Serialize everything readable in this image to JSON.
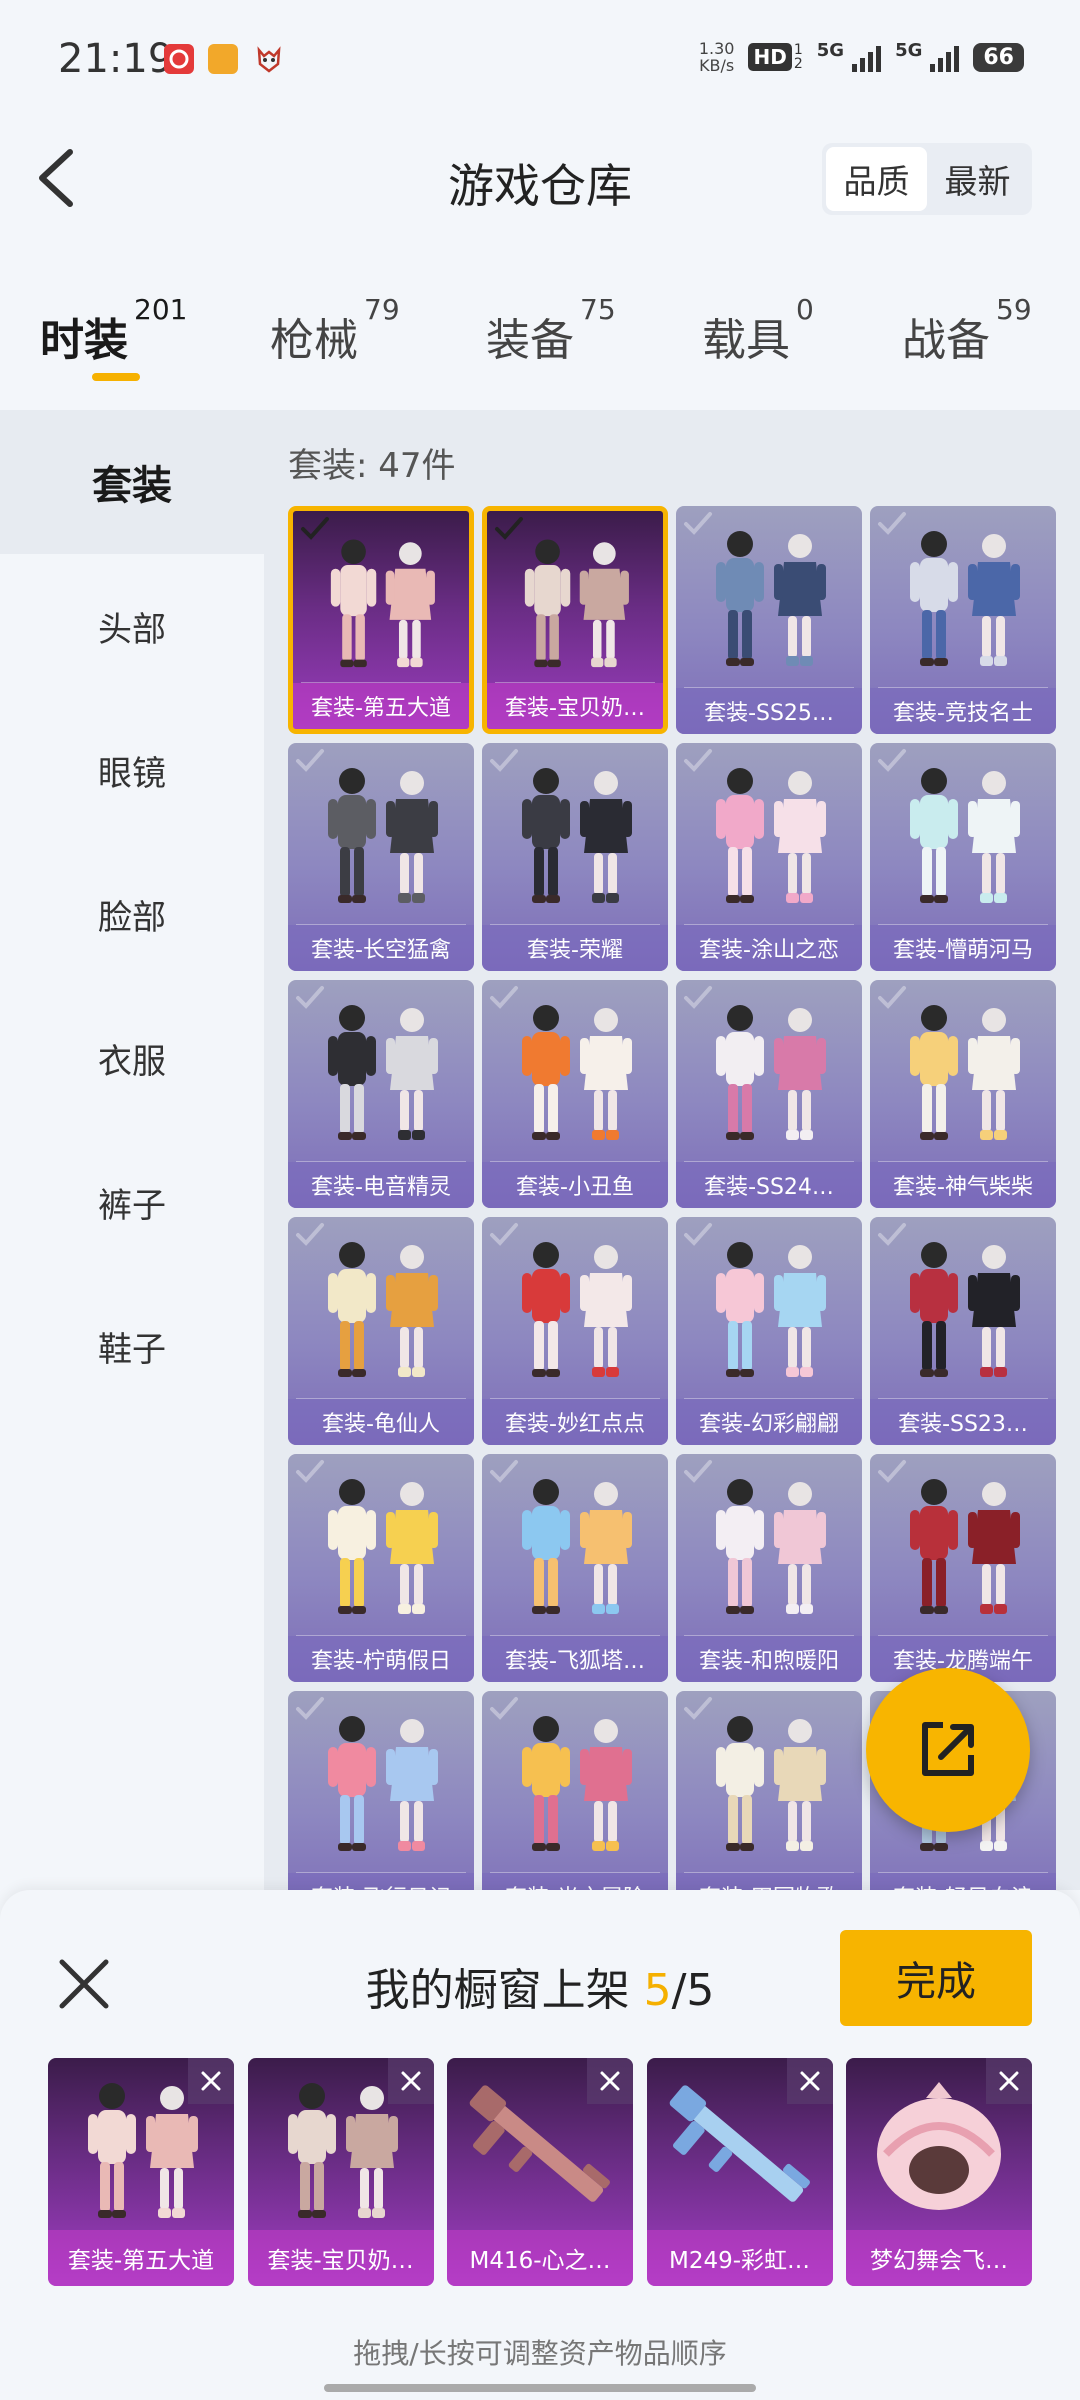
{
  "status_bar": {
    "time": "21:19",
    "net_speed_value": "1.30",
    "net_speed_unit": "KB/s",
    "hd_label": "HD",
    "sim1": "1",
    "sim2": "2",
    "sig1_label": "5G",
    "sig2_label": "5G",
    "battery": "66",
    "app_icons": [
      "netease-music-icon",
      "game-app-icon",
      "demon-mask-icon"
    ]
  },
  "header": {
    "title": "游戏仓库",
    "sort_options": [
      "品质",
      "最新"
    ],
    "sort_selected": "品质"
  },
  "tabs": [
    {
      "label": "时装",
      "count": "201",
      "active": true
    },
    {
      "label": "枪械",
      "count": "79",
      "active": false
    },
    {
      "label": "装备",
      "count": "75",
      "active": false
    },
    {
      "label": "载具",
      "count": "0",
      "active": false
    },
    {
      "label": "战备",
      "count": "59",
      "active": false
    }
  ],
  "sidebar": {
    "items": [
      {
        "label": "套装",
        "active": true
      },
      {
        "label": "头部",
        "active": false
      },
      {
        "label": "眼镜",
        "active": false
      },
      {
        "label": "脸部",
        "active": false
      },
      {
        "label": "衣服",
        "active": false
      },
      {
        "label": "裤子",
        "active": false
      },
      {
        "label": "鞋子",
        "active": false
      }
    ]
  },
  "main": {
    "count_text": "套装: 47件",
    "items": [
      {
        "label": "套装-第五大道",
        "selected": true,
        "colors": [
          "#f2d9d4",
          "#e9b9b5"
        ]
      },
      {
        "label": "套装-宝贝奶…",
        "selected": true,
        "colors": [
          "#e7d7cf",
          "#c9a8a0"
        ]
      },
      {
        "label": "套装-SS25…",
        "selected": false,
        "colors": [
          "#6f8bb5",
          "#3a4c74"
        ]
      },
      {
        "label": "套装-竞技名士",
        "selected": false,
        "colors": [
          "#d7dbe8",
          "#4b67a8"
        ]
      },
      {
        "label": "套装-长空猛禽",
        "selected": false,
        "colors": [
          "#5c5d63",
          "#3c3d44"
        ]
      },
      {
        "label": "套装-荣耀",
        "selected": false,
        "colors": [
          "#3a3b44",
          "#2a2b33"
        ]
      },
      {
        "label": "套装-涂山之恋",
        "selected": false,
        "colors": [
          "#f1a9c9",
          "#f6e0e8"
        ]
      },
      {
        "label": "套装-懵萌河马",
        "selected": false,
        "colors": [
          "#c9ecee",
          "#eef4f6"
        ]
      },
      {
        "label": "套装-电音精灵",
        "selected": false,
        "colors": [
          "#2e2e33",
          "#d9d9de"
        ]
      },
      {
        "label": "套装-小丑鱼",
        "selected": false,
        "colors": [
          "#f07a30",
          "#f6f0ea"
        ]
      },
      {
        "label": "套装-SS24…",
        "selected": false,
        "colors": [
          "#f2eef2",
          "#d87aa9"
        ]
      },
      {
        "label": "套装-神气柴柴",
        "selected": false,
        "colors": [
          "#f6d07a",
          "#f3f0ea"
        ]
      },
      {
        "label": "套装-龟仙人",
        "selected": false,
        "colors": [
          "#f2e8c8",
          "#e6a040"
        ]
      },
      {
        "label": "套装-妙红点点",
        "selected": false,
        "colors": [
          "#d83a3a",
          "#f3e8e8"
        ]
      },
      {
        "label": "套装-幻彩翩翩",
        "selected": false,
        "colors": [
          "#f6c7d6",
          "#a6d6f2"
        ]
      },
      {
        "label": "套装-SS23…",
        "selected": false,
        "colors": [
          "#b83040",
          "#222228"
        ]
      },
      {
        "label": "套装-柠萌假日",
        "selected": false,
        "colors": [
          "#f7f0e0",
          "#f6d050"
        ]
      },
      {
        "label": "套装-飞狐塔…",
        "selected": false,
        "colors": [
          "#8cc8f0",
          "#f6c070"
        ]
      },
      {
        "label": "套装-和煦暖阳",
        "selected": false,
        "colors": [
          "#f3eef3",
          "#f0c7d6"
        ]
      },
      {
        "label": "套装-龙腾端午",
        "selected": false,
        "colors": [
          "#b8303a",
          "#8a2028"
        ]
      },
      {
        "label": "套装-飞行日记",
        "selected": false,
        "colors": [
          "#f08aa0",
          "#a8c8f0"
        ]
      },
      {
        "label": "套装-光之冒险",
        "selected": false,
        "colors": [
          "#f6c050",
          "#e07090"
        ]
      },
      {
        "label": "套装-田园牧歌",
        "selected": false,
        "colors": [
          "#f3efe4",
          "#e8d8b8"
        ]
      },
      {
        "label": "套装-轻风白浪",
        "selected": false,
        "colors": [
          "#f3f3f3",
          "#b0c8e0"
        ]
      }
    ]
  },
  "fab": {
    "icon": "share-icon"
  },
  "showcase": {
    "title": "我的橱窗上架",
    "current": "5",
    "separator": "/",
    "max": "5",
    "done_label": "完成",
    "hint": "拖拽/长按可调整资产物品顺序",
    "slots": [
      {
        "label": "套装-第五大道",
        "kind": "outfit",
        "colors": [
          "#f2d9d4",
          "#e9b9b5"
        ]
      },
      {
        "label": "套装-宝贝奶…",
        "kind": "outfit",
        "colors": [
          "#e7d7cf",
          "#c9a8a0"
        ]
      },
      {
        "label": "M416-心之…",
        "kind": "gun",
        "colors": [
          "#c98a86",
          "#a86a6a"
        ]
      },
      {
        "label": "M249-彩虹…",
        "kind": "gun",
        "colors": [
          "#a8d0f0",
          "#7aa8e0"
        ]
      },
      {
        "label": "梦幻舞会飞…",
        "kind": "helmet",
        "colors": [
          "#f6d0d8",
          "#e8a0b0"
        ]
      }
    ]
  }
}
